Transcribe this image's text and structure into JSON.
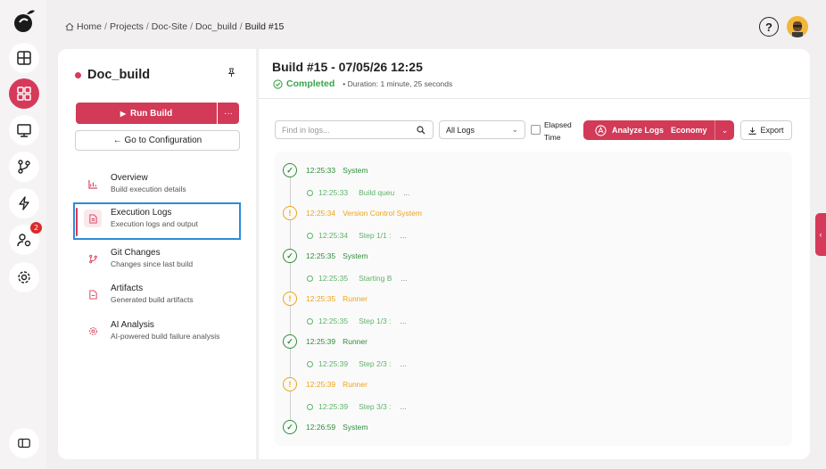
{
  "breadcrumb": {
    "items": [
      "Home",
      "Projects",
      "Doc-Site",
      "Doc_build"
    ],
    "current": "Build #15",
    "separator": "/"
  },
  "header": {
    "help_label": "?"
  },
  "rail": {
    "badge_count": "2",
    "icons": [
      "logo-icon",
      "dashboard-icon",
      "projects-icon",
      "monitor-icon",
      "branch-icon",
      "bolt-icon",
      "user-settings-icon",
      "settings-icon",
      "sidebar-toggle-icon"
    ]
  },
  "panel": {
    "project_name": "Doc_build",
    "run_label": "Run Build",
    "run_more": "···",
    "goto_label": "← Go to Configuration",
    "nav": [
      {
        "title": "Overview",
        "desc": "Build execution details"
      },
      {
        "title": "Execution Logs",
        "desc": "Execution logs and output"
      },
      {
        "title": "Git Changes",
        "desc": "Changes since last build"
      },
      {
        "title": "Artifacts",
        "desc": "Generated build artifacts"
      },
      {
        "title": "AI Analysis",
        "desc": "AI-powered build failure analysis"
      }
    ]
  },
  "main": {
    "title": "Build #15 - 07/05/26 12:25",
    "status": "Completed",
    "duration": "• Duration: 1 minute, 25 seconds",
    "search_placeholder": "Find in logs...",
    "filter_value": "All Logs",
    "elapsed_label": "Elapsed Time",
    "analyze_label": "Analyze Logs",
    "analyze_tier": "Economy",
    "export_label": "Export",
    "logs": [
      {
        "kind": "main",
        "status": "ok",
        "time": "12:25:33",
        "text": "System"
      },
      {
        "kind": "sub",
        "time": "12:25:33",
        "text": "Build queu",
        "ellipsis": "..."
      },
      {
        "kind": "main",
        "status": "warn",
        "time": "12:25:34",
        "text": "Version Control System"
      },
      {
        "kind": "sub",
        "time": "12:25:34",
        "text": "Step 1/1 :",
        "ellipsis": "..."
      },
      {
        "kind": "main",
        "status": "ok",
        "time": "12:25:35",
        "text": "System"
      },
      {
        "kind": "sub",
        "time": "12:25:35",
        "text": "Starting B",
        "ellipsis": "..."
      },
      {
        "kind": "main",
        "status": "warn",
        "time": "12:25:35",
        "text": "Runner"
      },
      {
        "kind": "sub",
        "time": "12:25:35",
        "text": "Step 1/3 :",
        "ellipsis": "..."
      },
      {
        "kind": "main",
        "status": "ok",
        "time": "12:25:39",
        "text": "Runner"
      },
      {
        "kind": "sub",
        "time": "12:25:39",
        "text": "Step 2/3 :",
        "ellipsis": "..."
      },
      {
        "kind": "main",
        "status": "warn",
        "time": "12:25:39",
        "text": "Runner"
      },
      {
        "kind": "sub",
        "time": "12:25:39",
        "text": "Step 3/3 :",
        "ellipsis": "..."
      },
      {
        "kind": "main",
        "status": "ok",
        "time": "12:26:59",
        "text": "System"
      }
    ]
  },
  "colors": {
    "accent": "#d23a58",
    "ok": "#2f8f3a",
    "warn": "#f0a416",
    "highlight": "#2b8ed8"
  }
}
